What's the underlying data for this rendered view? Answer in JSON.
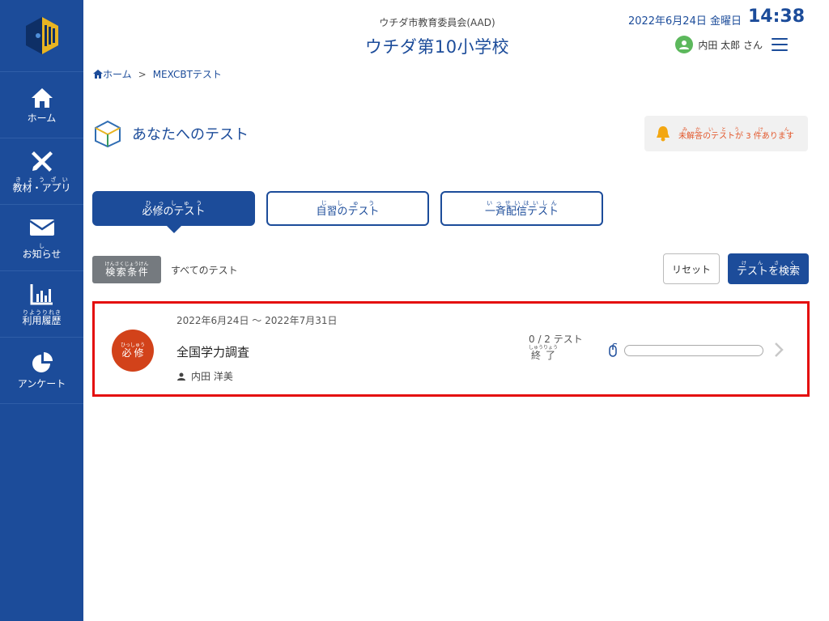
{
  "sidebar": {
    "items": [
      {
        "label": "ホーム",
        "icon": "home-icon"
      },
      {
        "label": "教材・アプリ",
        "ruby": "きょうざい",
        "icon": "tools-icon"
      },
      {
        "label": "お知らせ",
        "ruby": "し",
        "icon": "mail-icon"
      },
      {
        "label": "利用履歴",
        "ruby": "りようりれき",
        "icon": "bar-chart-icon"
      },
      {
        "label": "アンケート",
        "icon": "pie-chart-icon"
      }
    ]
  },
  "header": {
    "subtitle": "ウチダ市教育委員会(AAD)",
    "title": "ウチダ第10小学校",
    "date": "2022年6月24日 金曜日",
    "time": "14:38",
    "user": "内田 太郎 さん"
  },
  "breadcrumb": {
    "home": "ホーム",
    "separator": ">",
    "current": "MEXCBTテスト"
  },
  "page_title": "あなたへのテスト",
  "alert": {
    "prefix": "未解答のテストが",
    "count": "3",
    "suffix": "件あります"
  },
  "tabs": [
    {
      "label": "必修のテスト",
      "active": true
    },
    {
      "label": "自習のテスト",
      "active": false
    },
    {
      "label": "一斉配信テスト",
      "active": false
    }
  ],
  "filter": {
    "label": "検索条件",
    "value": "すべてのテスト"
  },
  "buttons": {
    "reset": "リセット",
    "search": "テストを検索"
  },
  "test_card": {
    "badge": "必修",
    "date_range": "2022年6月24日 〜 2022年7月31日",
    "title": "全国学力調査",
    "author": "内田 洋美",
    "progress": "0 / 2 テスト",
    "status": "終了",
    "progress_fraction": 0
  },
  "colors": {
    "primary": "#1c4c9a",
    "badge": "#d2421a",
    "highlight": "#e40d0d",
    "alert": "#e2562a"
  }
}
